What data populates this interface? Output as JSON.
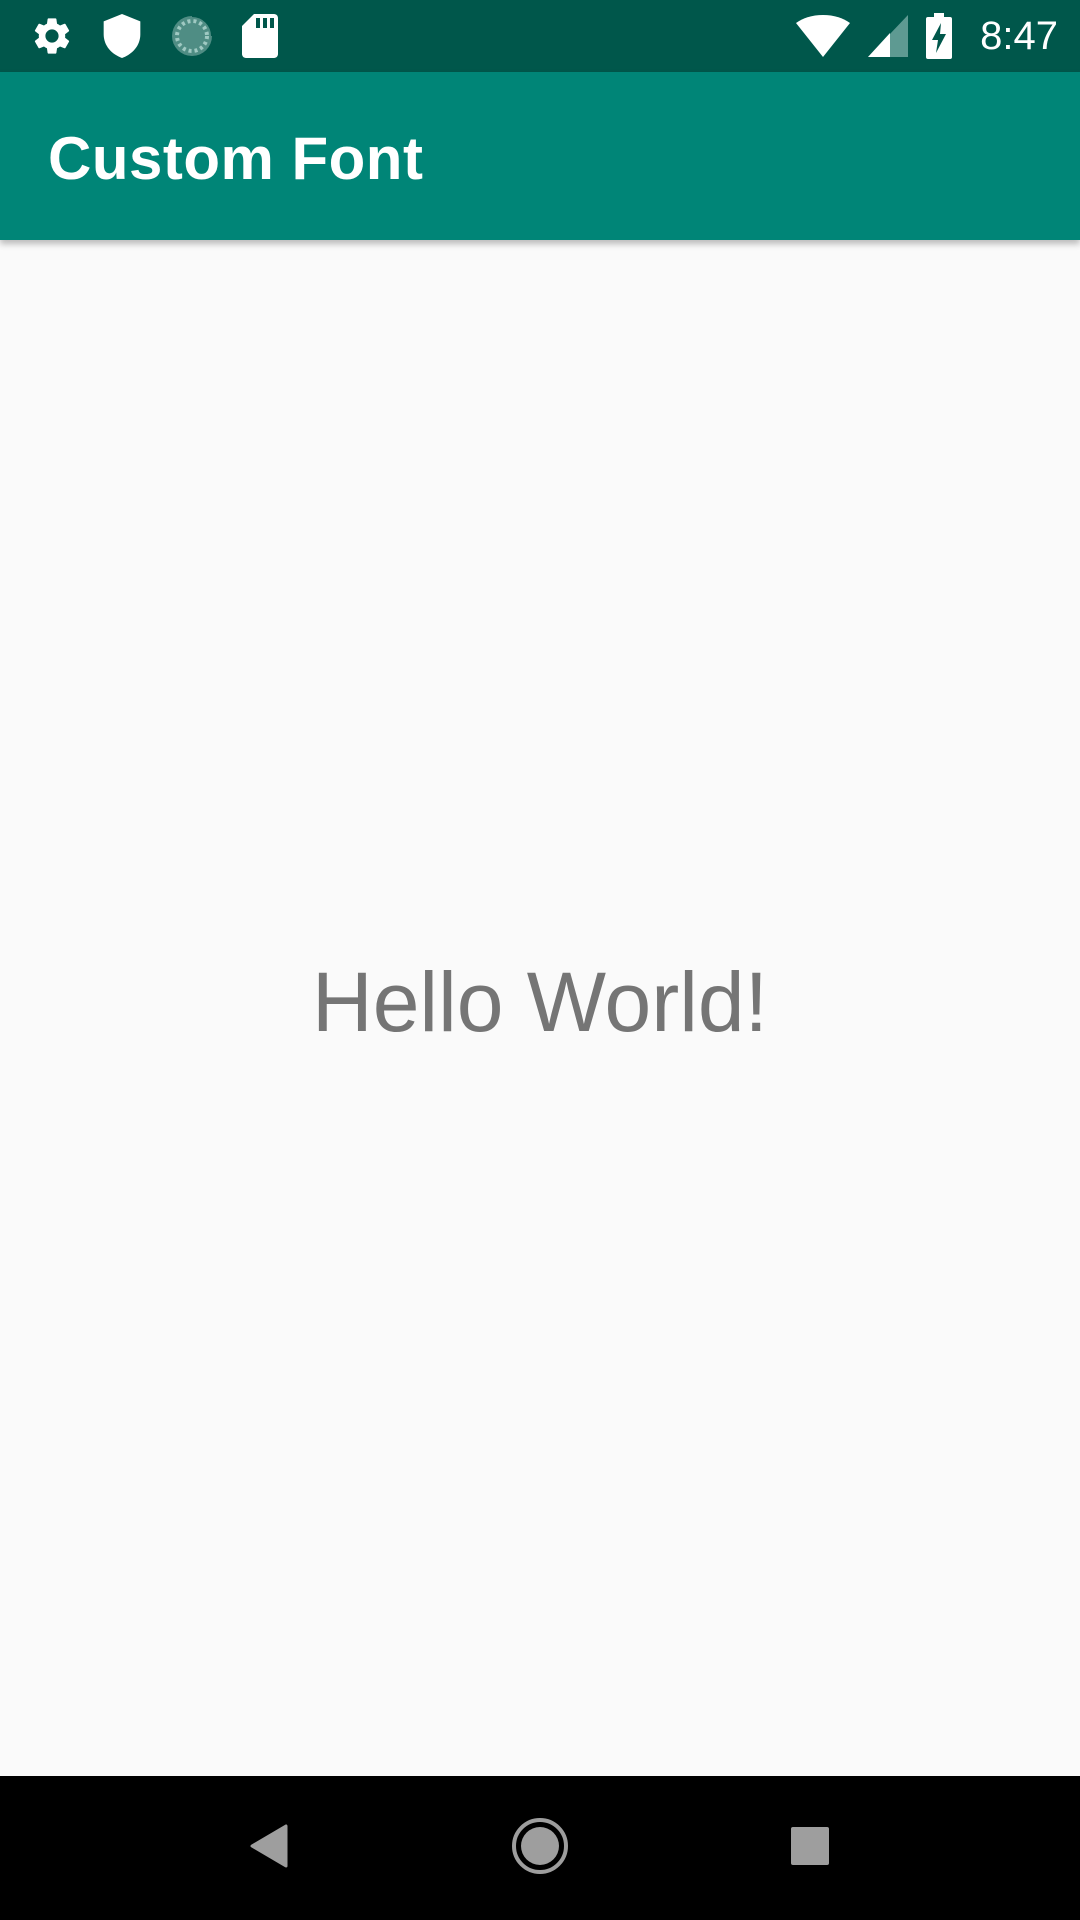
{
  "status_bar": {
    "time": "8:47",
    "left_icons": [
      "gear-icon",
      "shield-icon",
      "sync-icon",
      "sd-card-icon"
    ],
    "right_icons": [
      "wifi-icon",
      "signal-icon",
      "battery-charging-icon"
    ],
    "background": "#00574b"
  },
  "app_bar": {
    "title": "Custom Font",
    "background": "#008577"
  },
  "content": {
    "text": "Hello World!",
    "text_color": "#757575",
    "background": "#fafafa"
  },
  "nav_bar": {
    "buttons": [
      "back-icon",
      "home-icon",
      "recents-icon"
    ],
    "background": "#000000"
  }
}
